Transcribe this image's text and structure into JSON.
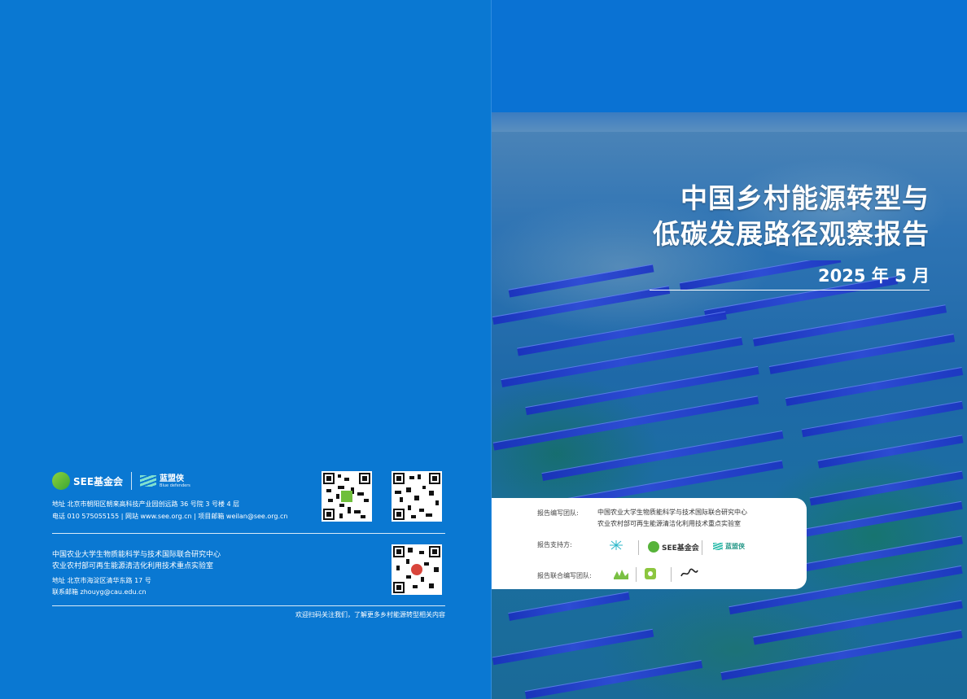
{
  "front": {
    "title_line1": "中国乡村能源转型与",
    "title_line2": "低碳发展路径观察报告",
    "date": "2025 年 5 月",
    "card": {
      "compile_label": "报告编写团队:",
      "compile_org1": "中国农业大学生物质能科学与技术国际联合研究中心",
      "compile_org2": "农业农村部可再生能源清洁化利用技术重点实验室",
      "support_label": "报告支持方:",
      "support_logos": [
        "SEE基金会",
        "蓝盟侠"
      ],
      "joint_label": "报告联合编写团队:"
    }
  },
  "back": {
    "logo_see": "SEE基金会",
    "logo_lanb": "蓝盟侠",
    "logo_lanb_sub": "Blue defenders",
    "see_address": "地址 北京市朝阳区朝来高科技产业园创远路 36 号院 3 号楼 4 层",
    "see_contact": "电话 010 575055155 | 网站 www.see.org.cn | 项目邮箱 weilan@see.org.cn",
    "cau_name1": "中国农业大学生物质能科学与技术国际联合研究中心",
    "cau_name2": "农业农村部可再生能源清洁化利用技术重点实验室",
    "cau_address": "地址  北京市海淀区清华东路 17 号",
    "cau_email": "联系邮箱  zhouyg@cau.edu.cn",
    "welcome": "欢迎扫码关注我们，了解更多乡村能源转型相关内容"
  },
  "colors": {
    "cover_blue": "#0a78d2",
    "panel_blue": "#2e49d8",
    "white": "#ffffff"
  },
  "icons": [
    "see-logo-icon",
    "lanb-logo-icon",
    "qr-code-icon"
  ]
}
